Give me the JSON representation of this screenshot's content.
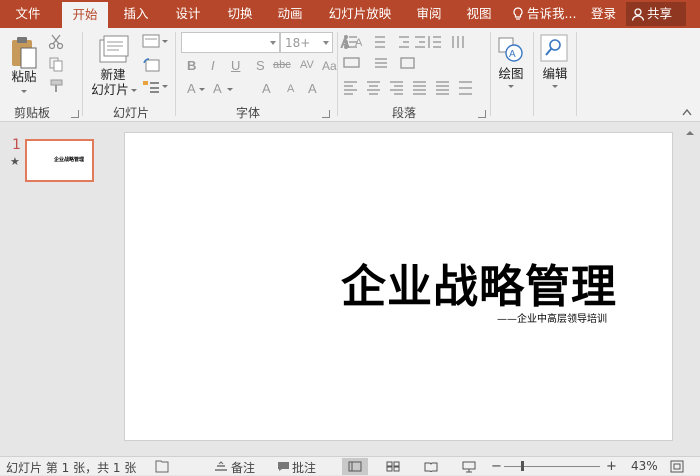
{
  "tabs": [
    {
      "label": "文件",
      "active": false
    },
    {
      "label": "开始",
      "active": true
    },
    {
      "label": "插入",
      "active": false
    },
    {
      "label": "设计",
      "active": false
    },
    {
      "label": "切换",
      "active": false
    },
    {
      "label": "动画",
      "active": false
    },
    {
      "label": "幻灯片放映",
      "active": false
    },
    {
      "label": "审阅",
      "active": false
    },
    {
      "label": "视图",
      "active": false
    }
  ],
  "tell_me": "告诉我...",
  "login": "登录",
  "share": "共享",
  "ribbon": {
    "clipboard": {
      "label": "剪贴板",
      "paste": "粘贴"
    },
    "slides": {
      "label": "幻灯片",
      "new_slide_line1": "新建",
      "new_slide_line2": "幻灯片"
    },
    "font": {
      "label": "字体",
      "font_name": "",
      "font_size": "18+"
    },
    "paragraph": {
      "label": "段落"
    },
    "drawing": {
      "label": "绘图"
    },
    "editing": {
      "label": "编辑"
    }
  },
  "thumbnail": {
    "number": "1",
    "star": "★",
    "title": "企业战略管理"
  },
  "slide": {
    "title": "企业战略管理",
    "subtitle": "——企业中高层领导培训"
  },
  "status": {
    "slide_info": "幻灯片 第 1 张，共 1 张",
    "notes": "备注",
    "comments": "批注",
    "zoom": "43%"
  },
  "colors": {
    "accent": "#b7472a",
    "share_bg": "#8f3720"
  }
}
